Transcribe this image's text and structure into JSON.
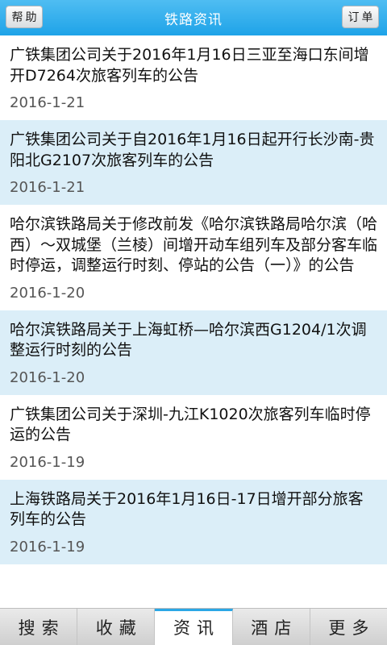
{
  "header": {
    "title": "铁路资讯",
    "left_button": "帮助",
    "right_button": "订单",
    "color": "#2aa8ea"
  },
  "items": [
    {
      "title": "广铁集团公司关于2016年1月16日三亚至海口东间增开D7264次旅客列车的公告",
      "date": "2016-1-21"
    },
    {
      "title": "广铁集团公司关于自2016年1月16日起开行长沙南-贵阳北G2107次旅客列车的公告",
      "date": "2016-1-21"
    },
    {
      "title": "哈尔滨铁路局关于修改前发《哈尔滨铁路局哈尔滨（哈西）～双城堡（兰棱）间增开动车组列车及部分客车临时停运，调整运行时刻、停站的公告（一）》的公告",
      "date": "2016-1-20"
    },
    {
      "title": "哈尔滨铁路局关于上海虹桥—哈尔滨西G1204/1次调整运行时刻的公告",
      "date": "2016-1-20"
    },
    {
      "title": "广铁集团公司关于深圳-九江K1020次旅客列车临时停运的公告",
      "date": "2016-1-19"
    },
    {
      "title": "上海铁路局关于2016年1月16日-17日增开部分旅客列车的公告",
      "date": "2016-1-19"
    }
  ],
  "tabs": [
    {
      "label": "搜索",
      "active": false
    },
    {
      "label": "收藏",
      "active": false
    },
    {
      "label": "资讯",
      "active": true
    },
    {
      "label": "酒店",
      "active": false
    },
    {
      "label": "更多",
      "active": false
    }
  ]
}
